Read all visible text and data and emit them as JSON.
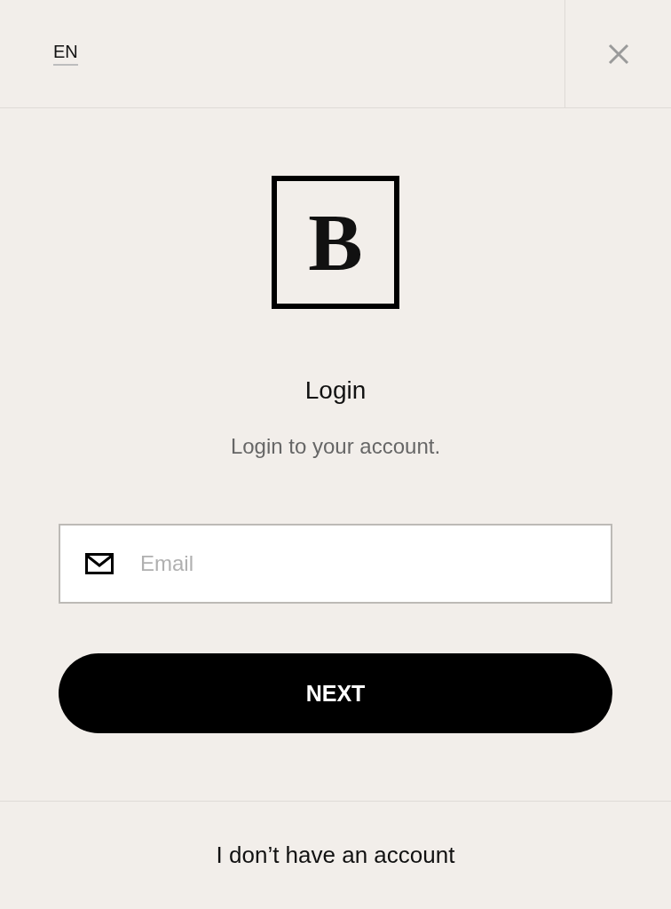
{
  "header": {
    "language": {
      "label": "EN",
      "selected": true
    }
  },
  "logo": {
    "letter": "B"
  },
  "title": "Login",
  "subtitle": "Login to your account.",
  "email_field": {
    "placeholder": "Email"
  },
  "next_button": {
    "label": "NEXT"
  },
  "footer": {
    "link": "I don’t have an account"
  }
}
